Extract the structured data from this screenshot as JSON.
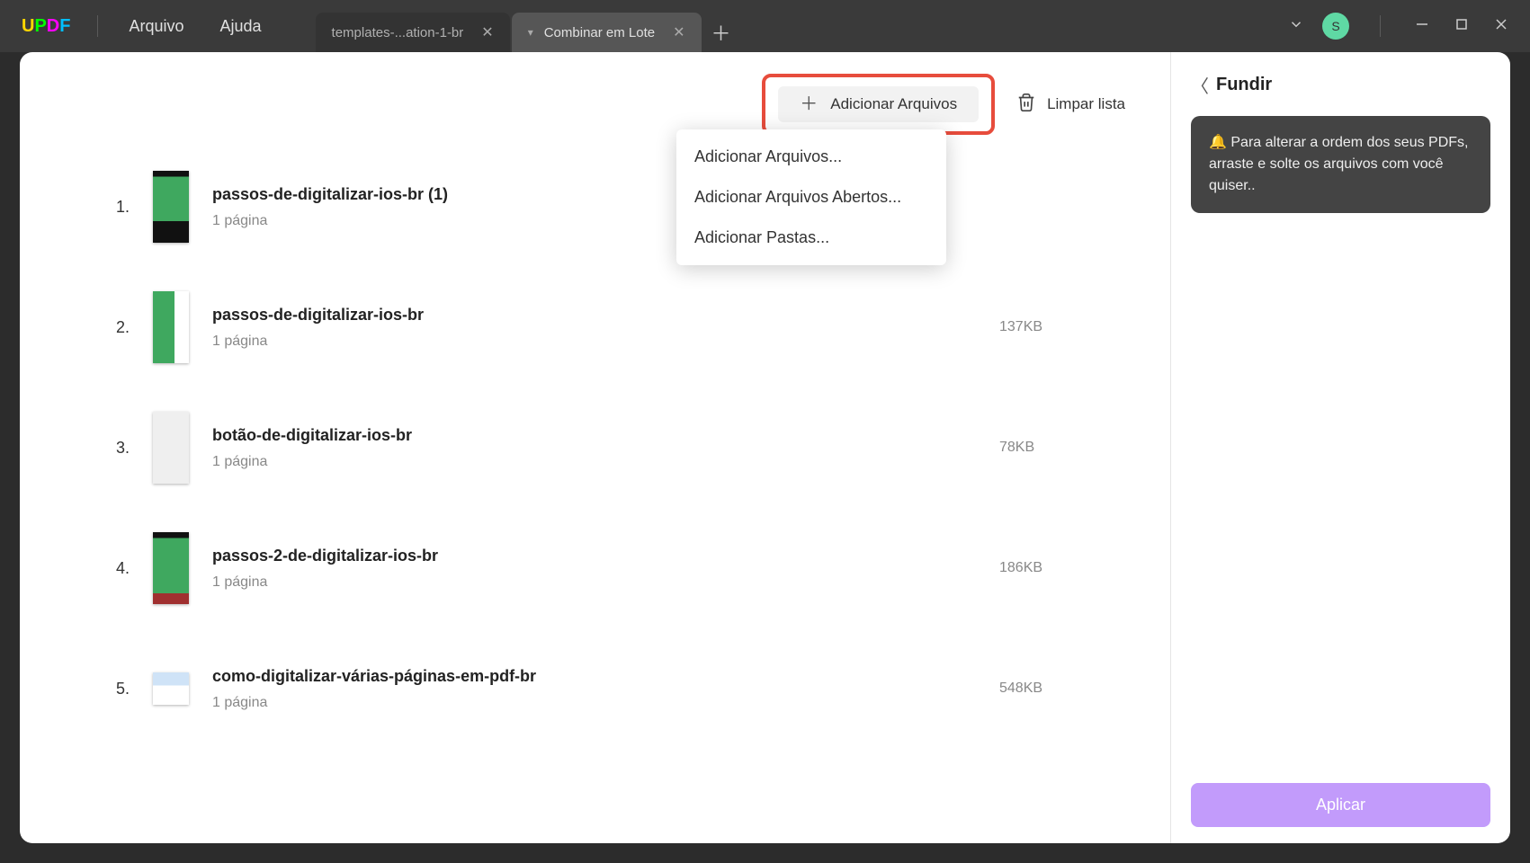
{
  "menu": {
    "arquivo": "Arquivo",
    "ajuda": "Ajuda"
  },
  "avatar": "S",
  "tabs": {
    "inactive": {
      "label": "templates-...ation-1-br"
    },
    "active": {
      "label": "Combinar em Lote"
    }
  },
  "toolbar": {
    "add_label": "Adicionar Arquivos",
    "clear_label": "Limpar lista"
  },
  "dropdown": {
    "item1": "Adicionar Arquivos...",
    "item2": "Adicionar Arquivos Abertos...",
    "item3": "Adicionar Pastas..."
  },
  "files": [
    {
      "index": "1.",
      "name": "passos-de-digitalizar-ios-br (1)",
      "pages": "1 página",
      "size": ""
    },
    {
      "index": "2.",
      "name": "passos-de-digitalizar-ios-br",
      "pages": "1 página",
      "size": "137KB"
    },
    {
      "index": "3.",
      "name": "botão-de-digitalizar-ios-br",
      "pages": "1 página",
      "size": "78KB"
    },
    {
      "index": "4.",
      "name": "passos-2-de-digitalizar-ios-br",
      "pages": "1 página",
      "size": "186KB"
    },
    {
      "index": "5.",
      "name": "como-digitalizar-várias-páginas-em-pdf-br",
      "pages": "1 página",
      "size": "548KB"
    }
  ],
  "panel": {
    "title": "Fundir",
    "hint": "🔔  Para alterar a ordem dos seus PDFs, arraste e solte os arquivos com você quiser..",
    "apply": "Aplicar"
  }
}
